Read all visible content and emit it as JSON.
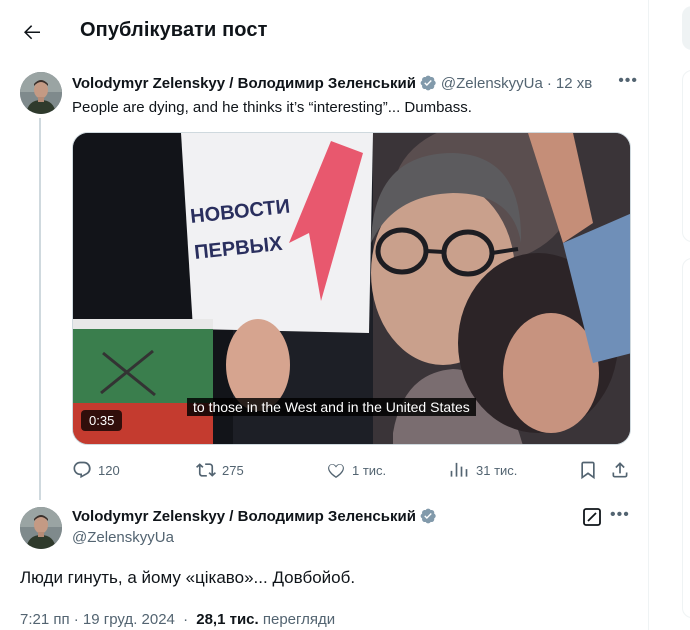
{
  "header": {
    "title": "Опублікувати пост",
    "back_icon": "arrow-left-icon"
  },
  "quoted": {
    "name": "Volodymyr Zelenskyy / Володимир Зеленський",
    "handle": "@ZelenskyyUa",
    "time": "12 хв",
    "separator": "·",
    "text": "People are dying, and he thinks it’s “interesting”... Dumbass.",
    "video": {
      "subtitle": "to those in the West and in the United States",
      "duration": "0:35",
      "sign_text_line1": "НОВОСТИ",
      "sign_text_line2": "ПЕРВЫХ"
    },
    "actions": {
      "replies": "120",
      "reposts": "275",
      "likes": "1 тис.",
      "views": "31 тис."
    }
  },
  "main": {
    "name": "Volodymyr Zelenskyy / Володимир Зеленський",
    "handle": "@ZelenskyyUa",
    "text": "Люди гинуть, а йому «цікаво»... Довбойоб.",
    "timestamp": "7:21 пп · 19 груд. 2024",
    "separator": "·",
    "views_count": "28,1 тис.",
    "views_label": "перегляди"
  },
  "colors": {
    "text": "#0f1419",
    "secondary": "#536471",
    "border": "#cfd9de",
    "verified": "#829aab"
  }
}
